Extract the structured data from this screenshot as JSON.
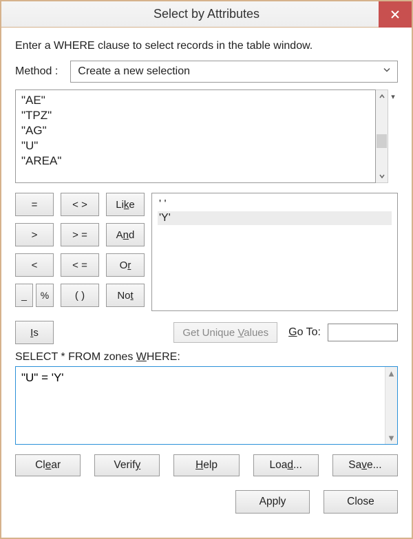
{
  "window": {
    "title": "Select by Attributes",
    "instruction": "Enter a WHERE clause to select records in the table window."
  },
  "method": {
    "label": "Method :",
    "selected": "Create a new selection"
  },
  "fields": {
    "items": [
      "\"AE\"",
      "\"TPZ\"",
      "\"AG\"",
      "\"U\"",
      "\"AREA\""
    ]
  },
  "operators": {
    "eq": "=",
    "neq": "< >",
    "like": "Like",
    "gt": ">",
    "gte": "> =",
    "and": "And",
    "lt": "<",
    "lte": "< =",
    "or": "Or",
    "underscore": "_",
    "percent": "%",
    "parens": "( )",
    "not": "Not",
    "is": "Is"
  },
  "values": {
    "items": [
      "' '",
      "'Y'"
    ],
    "selected_index": 1,
    "get_unique": "Get Unique Values",
    "goto_label": "Go To:",
    "goto_value": ""
  },
  "sql": {
    "label_prefix": "SELECT * FROM zones ",
    "label_where": "WHERE:",
    "expression": "\"U\" = 'Y'"
  },
  "buttons": {
    "clear": "Clear",
    "verify": "Verify",
    "help": "Help",
    "load": "Load...",
    "save": "Save...",
    "apply": "Apply",
    "close": "Close"
  }
}
